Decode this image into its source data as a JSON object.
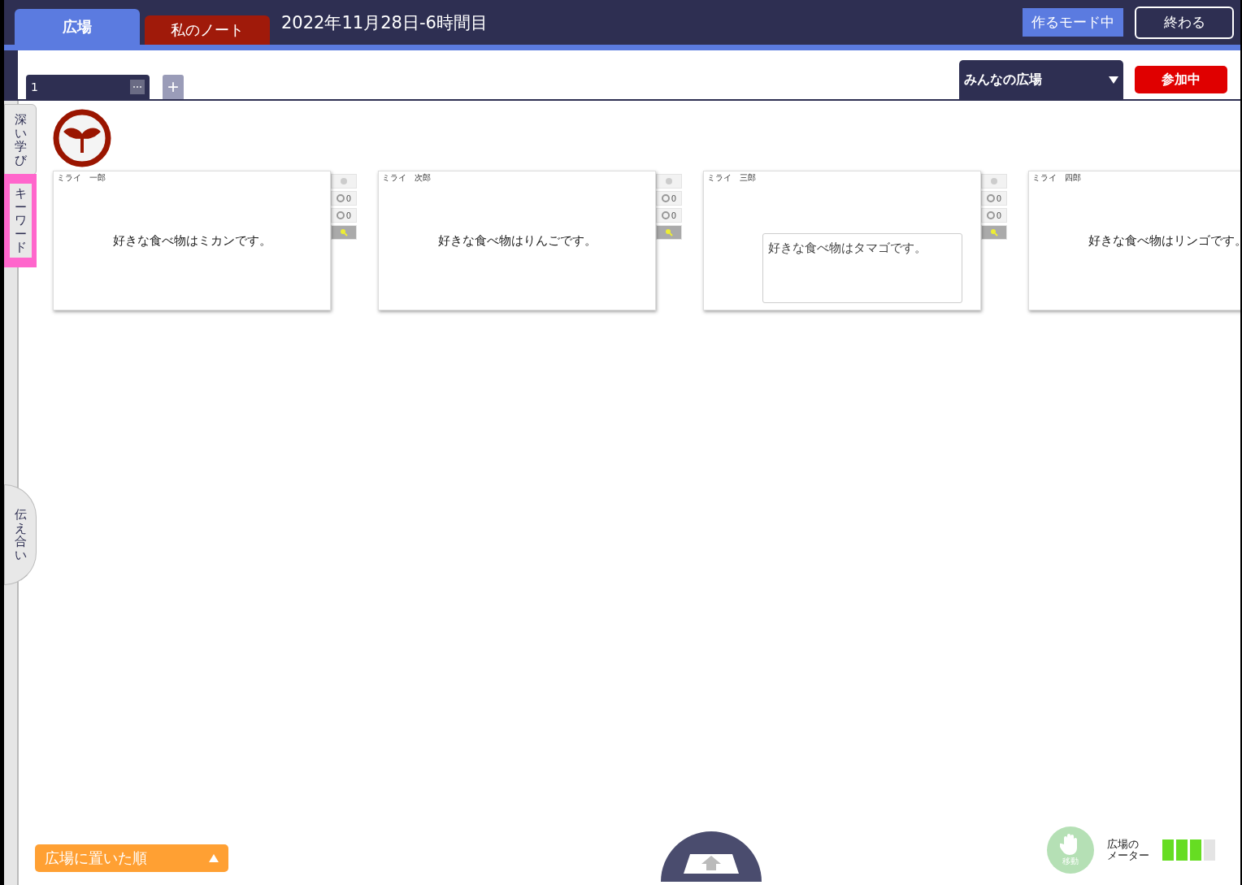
{
  "header": {
    "tabs": [
      {
        "label": "広場",
        "selected": true
      },
      {
        "label": "私のノート",
        "selected": false
      }
    ],
    "title": "2022年11月28日-6時間目",
    "mode_badge": "作るモード中",
    "end_button": "終わる"
  },
  "toolbar": {
    "pages": [
      {
        "label": "1",
        "selected": true
      }
    ],
    "menu_glyph": "⋯",
    "add_glyph": "+",
    "space_select": "みんなの広場",
    "join_button": "参加中"
  },
  "side_tabs": [
    {
      "label": "深い学び",
      "selected": false
    },
    {
      "label": "キーワード",
      "selected": true
    },
    {
      "label": "伝え合い",
      "selected": false
    }
  ],
  "cards": [
    {
      "author": "ミライ　一郎",
      "text": "好きな食べ物はミカンです。",
      "kind": "plain",
      "counts": [
        "0",
        "0"
      ]
    },
    {
      "author": "ミライ　次郎",
      "text": "好きな食べ物はりんごです。",
      "kind": "plain",
      "counts": [
        "0",
        "0"
      ]
    },
    {
      "author": "ミライ　三郎",
      "text": "好きな食べ物はタマゴです。",
      "kind": "boxed",
      "counts": [
        "0",
        "0"
      ]
    },
    {
      "author": "ミライ　四郎",
      "text": "好きな食べ物はリンゴです。",
      "kind": "plain"
    }
  ],
  "sort_button": "広場に置いた順",
  "move_button": "移動",
  "meter": {
    "label_lines": [
      "広場の",
      "メーター"
    ],
    "level": 0.75
  }
}
